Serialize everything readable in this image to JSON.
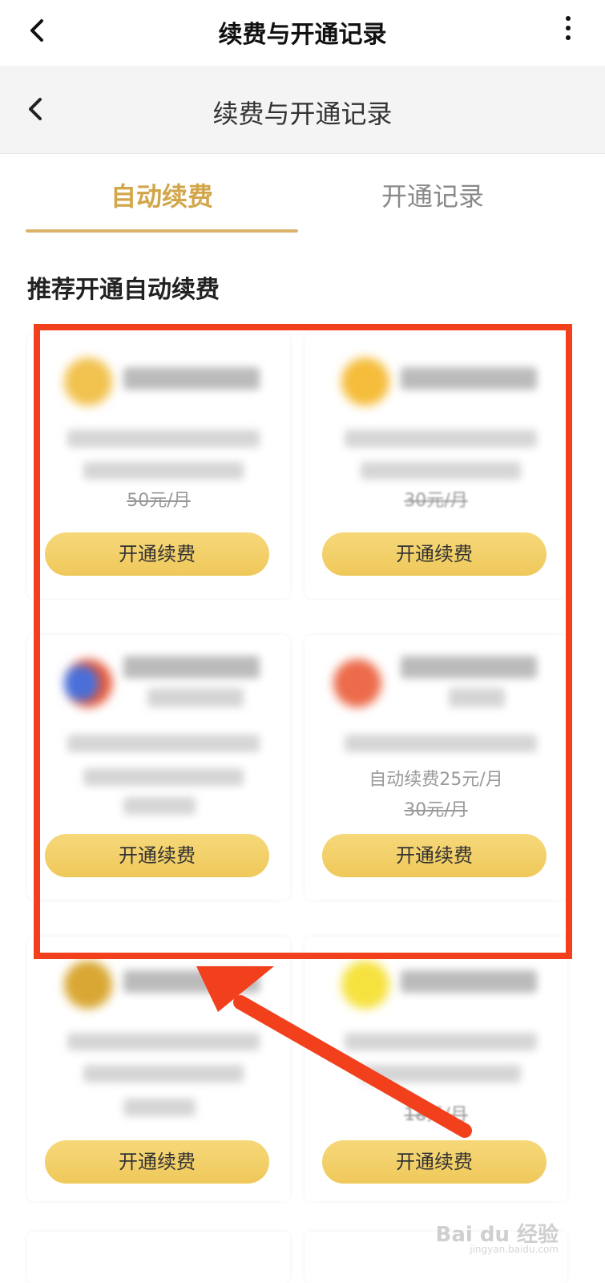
{
  "topbar": {
    "title": "续费与开通记录",
    "back_icon": "chevron-left-icon",
    "more_icon": "more-vertical-icon"
  },
  "subbar": {
    "title": "续费与开通记录",
    "back_icon": "chevron-left-icon"
  },
  "tabs": [
    {
      "label": "自动续费",
      "active": true
    },
    {
      "label": "开通记录",
      "active": false
    }
  ],
  "section_title": "推荐开通自动续费",
  "cards": [
    {
      "price": "50元/月",
      "button": "开通续费",
      "logo_color": "#f2c24f"
    },
    {
      "price": "30元/月",
      "button": "开通续费",
      "logo_color": "#f5bd3b"
    },
    {
      "button": "开通续费",
      "logo_color": "#4a6fd8"
    },
    {
      "auto_price": "自动续费25元/月",
      "price": "30元/月",
      "button": "开通续费",
      "logo_color": "#ec6b4a"
    },
    {
      "button": "开通续费",
      "logo_color": "#d9a733"
    },
    {
      "price": "18元/月",
      "button": "开通续费",
      "logo_color": "#f6e23f"
    }
  ],
  "watermark": {
    "text": "Bai du 经验",
    "sub": "jingyan.baidu.com"
  },
  "highlight_color": "#f23f1c"
}
